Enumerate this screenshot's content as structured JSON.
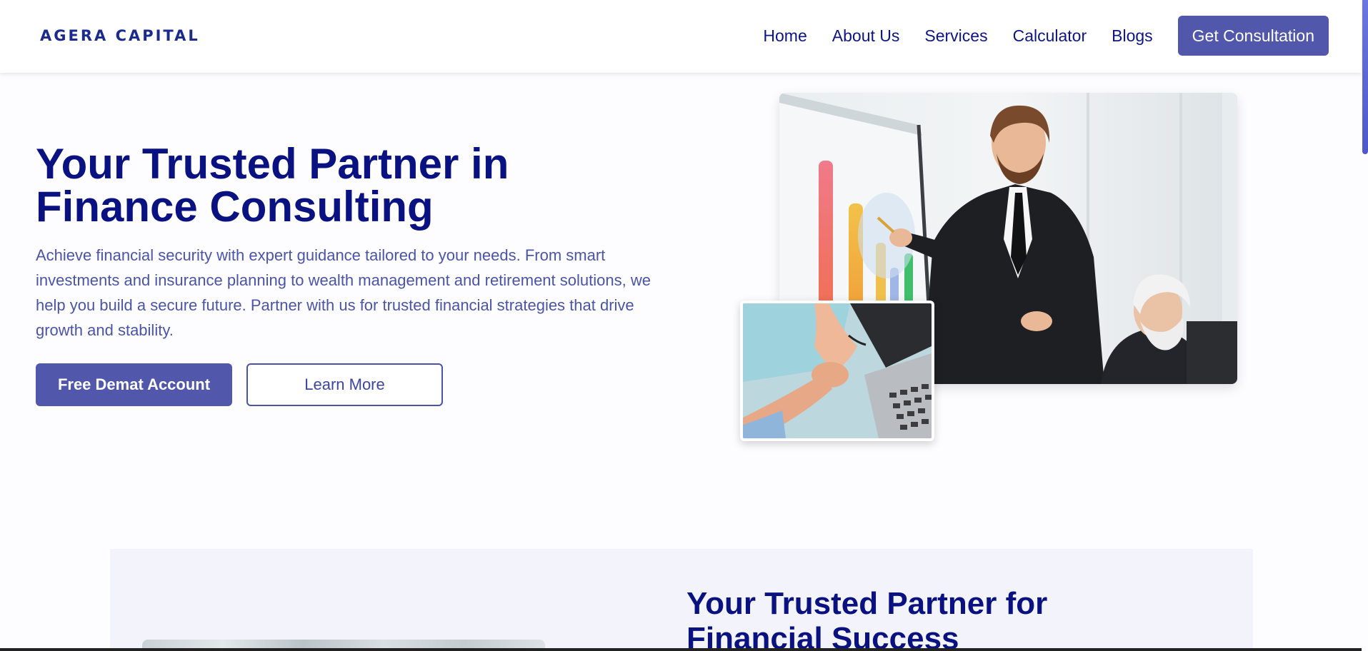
{
  "brand": {
    "logo_text": "AGERA CAPITAL"
  },
  "nav": {
    "links": [
      "Home",
      "About Us",
      "Services",
      "Calculator",
      "Blogs"
    ],
    "cta_label": "Get Consultation"
  },
  "hero": {
    "title": "Your Trusted Partner in Finance Consulting",
    "description": "Achieve financial security with expert guidance tailored to your needs. From smart investments and insurance planning to wealth management and retirement solutions, we help you build a secure future. Partner with us for trusted financial strategies that drive growth and stability.",
    "primary_button": "Free Demat Account",
    "secondary_button": "Learn More"
  },
  "section2": {
    "title": "Your Trusted Partner for Financial Success"
  },
  "colors": {
    "accent": "#5157aa",
    "heading": "#0a1180",
    "body_text": "#4a54a8",
    "section_bg": "#f3f4fb"
  }
}
